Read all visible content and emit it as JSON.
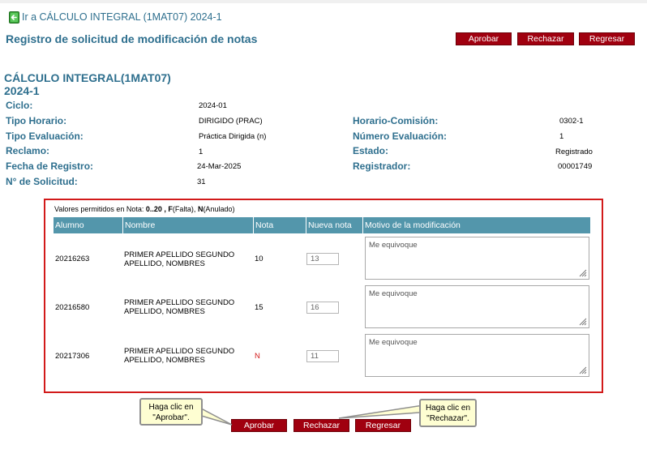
{
  "nav": {
    "back_link": "Ir a CÁLCULO INTEGRAL (1MAT07) 2024-1"
  },
  "page": {
    "title": "Registro de solicitud de modificación de notas"
  },
  "actions": {
    "approve": "Aprobar",
    "reject": "Rechazar",
    "back": "Regresar"
  },
  "course": {
    "name": "CÁLCULO INTEGRAL(1MAT07)",
    "period": "2024-1"
  },
  "details": {
    "ciclo_label": "Ciclo:",
    "ciclo": "2024-01",
    "tipo_horario_label": "Tipo Horario:",
    "tipo_horario": "DIRIGIDO (PRAC)",
    "horario_comision_label": "Horario-Comisión:",
    "horario_comision": "0302-1",
    "tipo_evaluacion_label": "Tipo Evaluación:",
    "tipo_evaluacion": "Práctica Dirigida (n)",
    "numero_evaluacion_label": "Número Evaluación:",
    "numero_evaluacion": "1",
    "reclamo_label": "Reclamo:",
    "reclamo": "1",
    "estado_label": "Estado:",
    "estado": "Registrado",
    "fecha_registro_label": "Fecha de Registro:",
    "fecha_registro": "24-Mar-2025",
    "registrador_label": "Registrador:",
    "registrador": "00001749",
    "solicitud_label": "N° de Solicitud:",
    "solicitud": "31"
  },
  "grades": {
    "allowed_prefix": "Valores permitidos en Nota: ",
    "allowed_range": "0..20 , F",
    "allowed_f": "(Falta), ",
    "allowed_n": "N",
    "allowed_suffix": "(Anulado)",
    "columns": [
      "Alumno",
      "Nombre",
      "Nota",
      "Nueva nota",
      "Motivo de la modificación"
    ],
    "rows": [
      {
        "alumno": "20216263",
        "nombre": "PRIMER APELLIDO SEGUNDO APELLIDO, NOMBRES",
        "nota": "10",
        "nueva_nota": "13",
        "motivo": "Me equivoque"
      },
      {
        "alumno": "20216580",
        "nombre": "PRIMER APELLIDO SEGUNDO APELLIDO, NOMBRES",
        "nota": "15",
        "nueva_nota": "16",
        "motivo": "Me equivoque"
      },
      {
        "alumno": "20217306",
        "nombre": "PRIMER APELLIDO SEGUNDO APELLIDO, NOMBRES",
        "nota": "N",
        "nueva_nota": "11",
        "motivo": "Me equivoque"
      }
    ]
  },
  "callouts": {
    "approve_line1": "Haga clic en",
    "approve_line2": "\"Aprobar\".",
    "reject_line1": "Haga clic en",
    "reject_line2": "\"Rechazar\"."
  },
  "colors": {
    "accent": "#2e6f8e",
    "button": "#a0000f",
    "header": "#5396ab",
    "panel_border": "#d21a1a"
  }
}
